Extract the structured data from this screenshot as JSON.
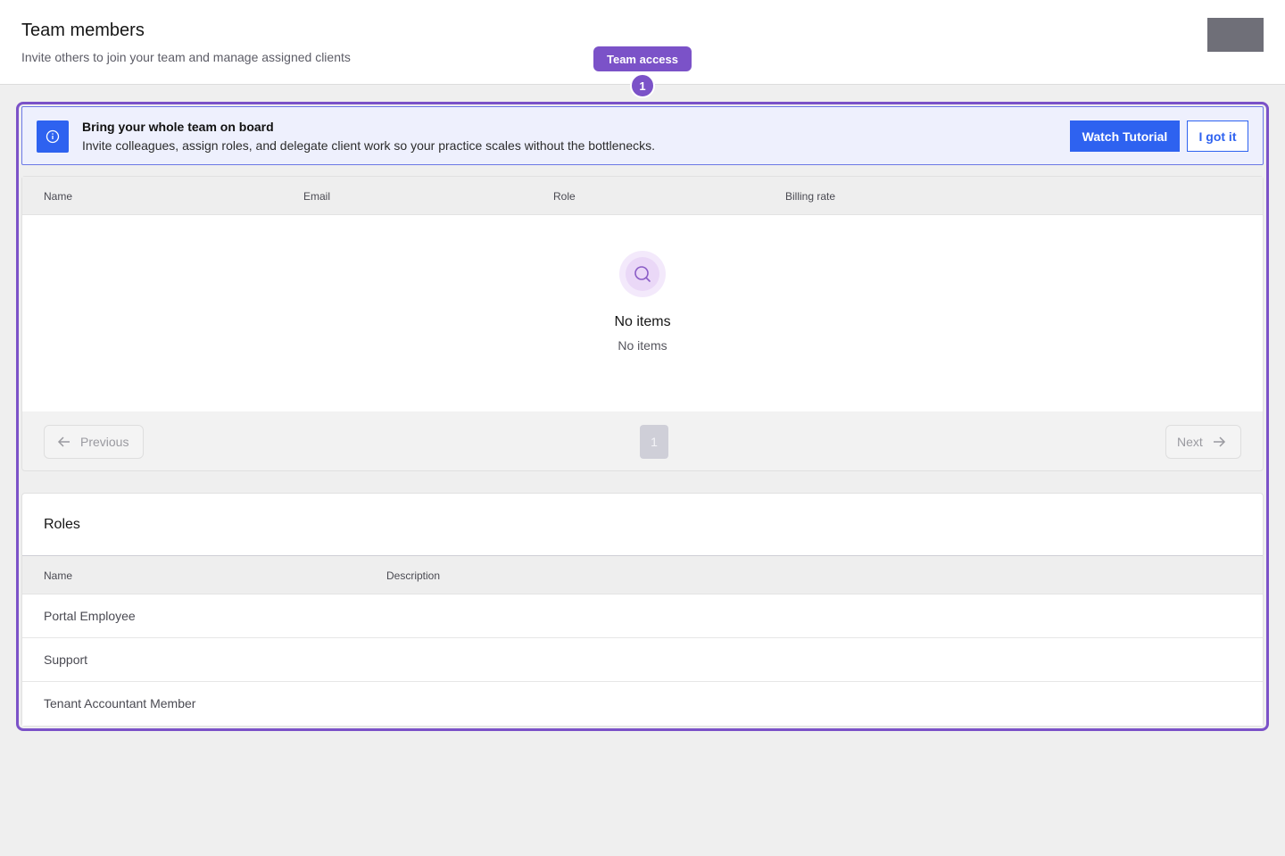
{
  "header": {
    "title": "Team members",
    "subtitle": "Invite others to join your team and manage assigned clients"
  },
  "tour": {
    "label": "Team access",
    "step": "1",
    "accent_color": "#7b52c8"
  },
  "banner": {
    "icon": "info-icon",
    "title": "Bring your whole team on board",
    "text": "Invite colleagues, assign roles, and delegate client work so your practice scales without the bottlenecks.",
    "primary_button": "Watch Tutorial",
    "secondary_button": "I got it",
    "accent_color": "#2e62f0"
  },
  "members": {
    "columns": [
      "Name",
      "Email",
      "Role",
      "Billing rate"
    ],
    "empty_icon": "search-icon",
    "empty_title": "No items",
    "empty_subtitle": "No items",
    "pagination": {
      "previous": "Previous",
      "next": "Next",
      "current_page": "1"
    }
  },
  "roles": {
    "title": "Roles",
    "columns": [
      "Name",
      "Description"
    ],
    "rows": [
      {
        "name": "Portal Employee",
        "description": ""
      },
      {
        "name": "Support",
        "description": ""
      },
      {
        "name": "Tenant Accountant Member",
        "description": ""
      }
    ]
  }
}
